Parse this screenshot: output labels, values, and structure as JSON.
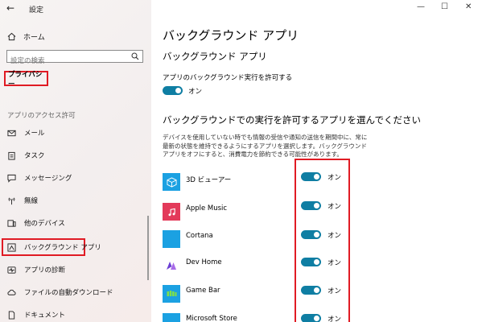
{
  "window": {
    "title": "設定",
    "controls": {
      "minimize": "—",
      "maximize": "☐",
      "close": "✕"
    }
  },
  "sidebar": {
    "home_label": "ホーム",
    "search_placeholder": "設定の検索",
    "category_label": "プライバシー",
    "section_header": "アプリのアクセス許可",
    "items": [
      {
        "label": "メール",
        "icon": "mail-icon"
      },
      {
        "label": "タスク",
        "icon": "tasks-icon"
      },
      {
        "label": "メッセージング",
        "icon": "message-icon"
      },
      {
        "label": "無線",
        "icon": "radio-icon"
      },
      {
        "label": "他のデバイス",
        "icon": "devices-icon"
      },
      {
        "label": "バックグラウンド アプリ",
        "icon": "background-apps-icon",
        "selected": true
      },
      {
        "label": "アプリの診断",
        "icon": "diagnostics-icon"
      },
      {
        "label": "ファイルの自動ダウンロード",
        "icon": "cloud-download-icon"
      },
      {
        "label": "ドキュメント",
        "icon": "document-icon"
      }
    ]
  },
  "main": {
    "page_title": "バックグラウンド アプリ",
    "section_title": "バックグラウンド アプリ",
    "allow_label": "アプリのバックグラウンド実行を許可する",
    "allow_state": "オン",
    "choose_title": "バックグラウンドでの実行を許可するアプリを選んでください",
    "description": "デバイスを使用していない時でも情報の受信や通知の送信を期間中に、常に最新の状態を維持できるようにするアプリを選択します。バックグラウンド アプリをオフにすると、消費電力を節約できる可能性があります。",
    "apps": [
      {
        "name": "3D ビューアー",
        "state": "オン",
        "icon_color": "#1ba1e2"
      },
      {
        "name": "Apple Music",
        "state": "オン",
        "icon_color": "#e33a5a"
      },
      {
        "name": "Cortana",
        "state": "オン",
        "icon_color": "#1ba1e2"
      },
      {
        "name": "Dev Home",
        "state": "オン",
        "icon_color": "#1ba1e2"
      },
      {
        "name": "Game Bar",
        "state": "オン",
        "icon_color": "#1ba1e2"
      },
      {
        "name": "Microsoft Store",
        "state": "オン",
        "icon_color": "#1ba1e2"
      }
    ]
  },
  "colors": {
    "accent": "#0f7ea3",
    "highlight": "#e01b24",
    "tile": "#1ba1e2"
  }
}
